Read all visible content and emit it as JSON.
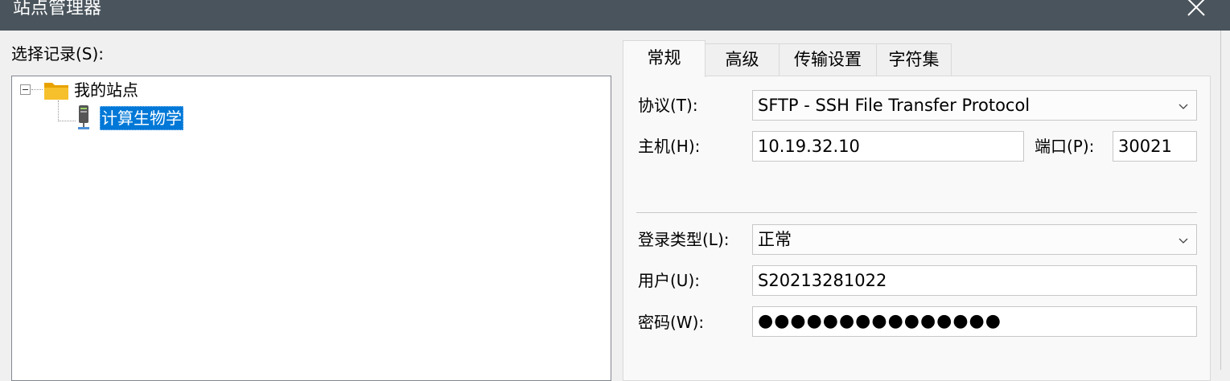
{
  "window": {
    "title": "站点管理器",
    "close_icon": "close-icon"
  },
  "left": {
    "select_label": "选择记录(S):",
    "tree": {
      "root_label": "我的站点",
      "site_label": "计算生物学"
    }
  },
  "tabs": [
    {
      "label": "常规",
      "active": true
    },
    {
      "label": "高级",
      "active": false
    },
    {
      "label": "传输设置",
      "active": false
    },
    {
      "label": "字符集",
      "active": false
    }
  ],
  "general": {
    "protocol_label": "协议(T):",
    "protocol_value": "SFTP - SSH File Transfer Protocol",
    "host_label": "主机(H):",
    "host_value": "10.19.32.10",
    "port_label": "端口(P):",
    "port_value": "30021",
    "logon_type_label": "登录类型(L):",
    "logon_type_value": "正常",
    "user_label": "用户(U):",
    "user_value": "S20213281022",
    "password_label": "密码(W):",
    "password_value": "●●●●●●●●●●●●●●●"
  },
  "colors": {
    "titlebar": "#4a545c",
    "selection": "#0078d7",
    "folder": "#f4b400"
  }
}
